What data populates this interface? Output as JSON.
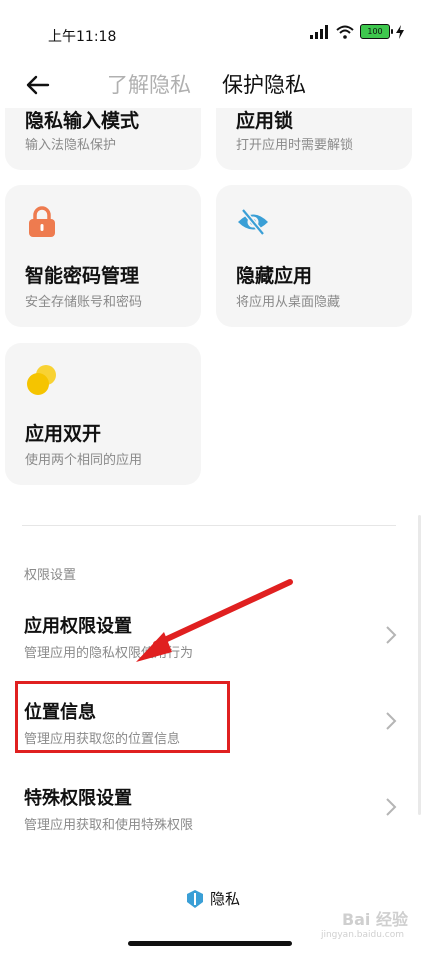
{
  "status": {
    "time": "上午11:18",
    "battery": "100"
  },
  "header": {
    "tab_learn": "了解隐私",
    "tab_protect": "保护隐私"
  },
  "cards_top": [
    {
      "title": "隐私输入模式",
      "subtitle": "输入法隐私保护"
    },
    {
      "title": "应用锁",
      "subtitle": "打开应用时需要解锁"
    }
  ],
  "cards": [
    {
      "title": "智能密码管理",
      "subtitle": "安全存储账号和密码",
      "icon": "lock-icon",
      "color": "#ee7b4f"
    },
    {
      "title": "隐藏应用",
      "subtitle": "将应用从桌面隐藏",
      "icon": "eye-off-icon",
      "color": "#3a9fd6"
    },
    {
      "title": "应用双开",
      "subtitle": "使用两个相同的应用",
      "icon": "dual-app-icon",
      "color": "#f5c400"
    }
  ],
  "permissions": {
    "section_title": "权限设置",
    "items": [
      {
        "title": "应用权限设置",
        "subtitle": "管理应用的隐私权限使用行为"
      },
      {
        "title": "位置信息",
        "subtitle": "管理应用获取您的位置信息"
      },
      {
        "title": "特殊权限设置",
        "subtitle": "管理应用获取和使用特殊权限"
      }
    ]
  },
  "footer": {
    "label": "隐私"
  },
  "watermark": {
    "text": "Bai 经验",
    "sub": "jingyan.baidu.com"
  },
  "colors": {
    "annotation": "#e02020"
  }
}
